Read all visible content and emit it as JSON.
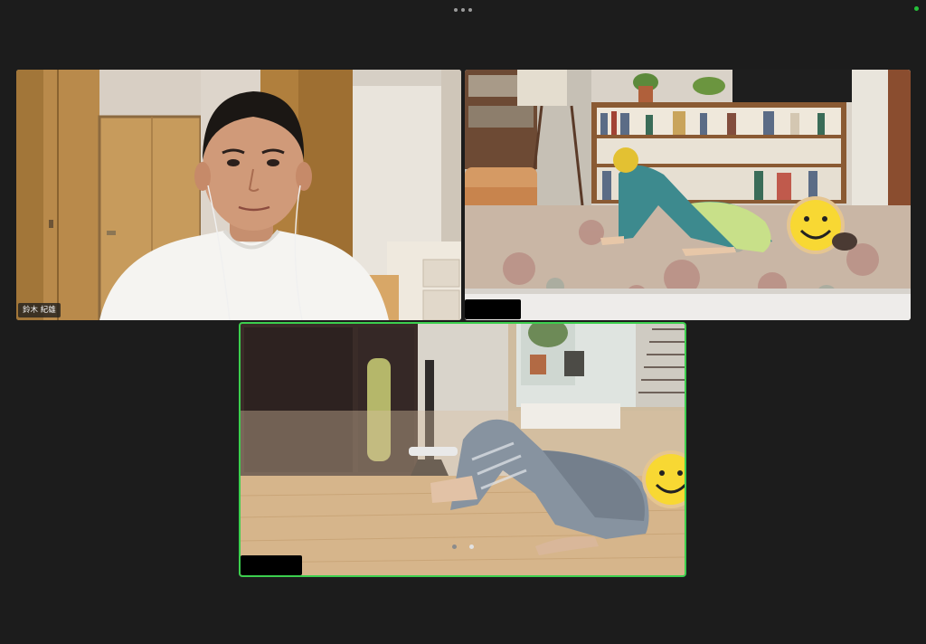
{
  "window": {
    "more_menu_icon": "more-horizontal-icon",
    "status_color": "#25c23a"
  },
  "participants": [
    {
      "name": "鈴木 紀雄",
      "active_speaker": false
    },
    {
      "name": "",
      "redacted": true,
      "active_speaker": false
    },
    {
      "name": "",
      "redacted": true,
      "active_speaker": true
    }
  ],
  "pagination": {
    "pages": 2,
    "current": 2
  },
  "colors": {
    "active_speaker_border": "#3ccf4e",
    "background": "#1c1c1c"
  }
}
